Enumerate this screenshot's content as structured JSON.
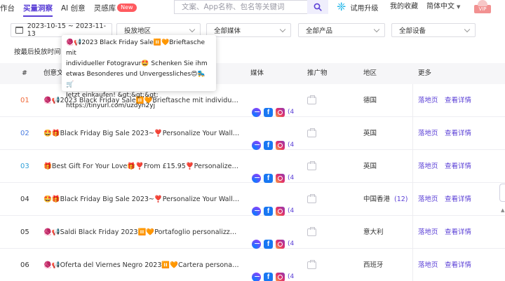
{
  "nav": {
    "items": [
      {
        "label": "作台",
        "active": false
      },
      {
        "label": "买量洞察",
        "active": true
      },
      {
        "label": "AI 创意",
        "active": false
      },
      {
        "label": "灵感库",
        "active": false
      }
    ],
    "new_badge": "New",
    "search_placeholder": "文案、App名称、包名等关键词",
    "upgrade": "试用升级",
    "favorites": "我的收藏",
    "language": "简体中文",
    "vip": "VIP"
  },
  "filters": {
    "date_range": "2023-10-15 ~ 2023-11-13",
    "region": "投放地区",
    "media": "全部媒体",
    "product": "全部产品",
    "device": "全部设备"
  },
  "sort_label": "按最后投放时间",
  "tooltip": {
    "line1": "🧶📢2023 Black Friday Sale⏸️🧡Brieftasche mit",
    "line2": "individueller Fotogravur🤩 Schenken Sie ihm",
    "line3": "etwas Besonderes und Unvergessliches😍🛼🛒",
    "line4": "Jetzt einkaufen! &gt;&gt;&gt;",
    "line5": "https://tinyurl.com/uzdyn2yj"
  },
  "table": {
    "headers": {
      "index": "#",
      "creative": "创意文",
      "media": "媒体",
      "promo": "推广物",
      "region": "地区",
      "more": "更多"
    },
    "rows": [
      {
        "index": "01",
        "title": "🧶📢2023 Black Friday Sale⏸️🧡Brieftasche mit individueller ...",
        "media_more": "(4",
        "region": "德国",
        "region_count": "",
        "action1": "落地页",
        "action2": "查看详情"
      },
      {
        "index": "02",
        "title": "🤩🎁Black Friday Big Sale 2023~❣️Personalize Your Wallet by...",
        "media_more": "(4",
        "region": "英国",
        "region_count": "",
        "action1": "落地页",
        "action2": "查看详情"
      },
      {
        "index": "03",
        "title": "🎁Best Gift For Your Love🎁❣️From £15.95❣️Personalize Wall...",
        "media_more": "(4",
        "region": "英国",
        "region_count": "",
        "action1": "落地页",
        "action2": "查看详情"
      },
      {
        "index": "04",
        "title": "🤩🎁Black Friday Big Sale 2023~❣️Personalize Your Wallet by...",
        "media_more": "(4",
        "region": "中国香港",
        "region_count": "(12)",
        "action1": "落地页",
        "action2": "查看详情"
      },
      {
        "index": "05",
        "title": "🧶📢Saldi Black Friday 2023⏸️🧡Portafoglio personalizzato c...",
        "media_more": "(4",
        "region": "意大利",
        "region_count": "",
        "action1": "落地页",
        "action2": "查看详情"
      },
      {
        "index": "06",
        "title": "🧶📢Oferta del Viernes Negro 2023⏸️🧡Cartera personaliza...",
        "media_more": "(4",
        "region": "西班牙",
        "region_count": "",
        "action1": "落地页",
        "action2": "查看详情"
      }
    ]
  },
  "colors": {
    "accent": "#5a3fd6",
    "row01": "#f06a3a",
    "row02": "#4a7de0",
    "row03": "#2f9fd8",
    "default_num": "#333333"
  }
}
